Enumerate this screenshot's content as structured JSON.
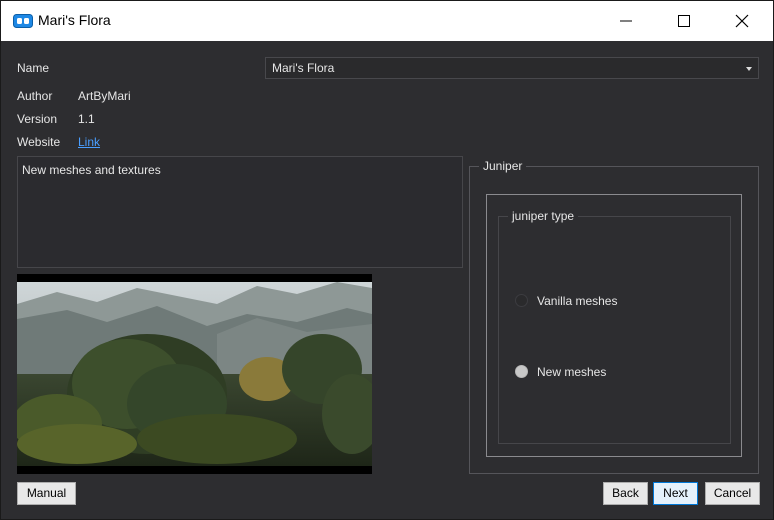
{
  "window": {
    "title": "Mari's Flora"
  },
  "fields": {
    "name_label": "Name",
    "name_value": "Mari's Flora",
    "author_label": "Author",
    "author_value": "ArtByMari",
    "version_label": "Version",
    "version_value": "1.1",
    "website_label": "Website",
    "website_link": "Link"
  },
  "description": "New meshes and textures",
  "group": {
    "title": "Juniper",
    "subgroup_title": "juniper type",
    "options": [
      {
        "label": "Vanilla meshes",
        "selected": false
      },
      {
        "label": "New meshes",
        "selected": true
      }
    ]
  },
  "buttons": {
    "manual": "Manual",
    "back": "Back",
    "next": "Next",
    "cancel": "Cancel"
  },
  "colors": {
    "background": "#2d2d30",
    "link": "#4a9eff",
    "titlebar": "#ffffff"
  }
}
